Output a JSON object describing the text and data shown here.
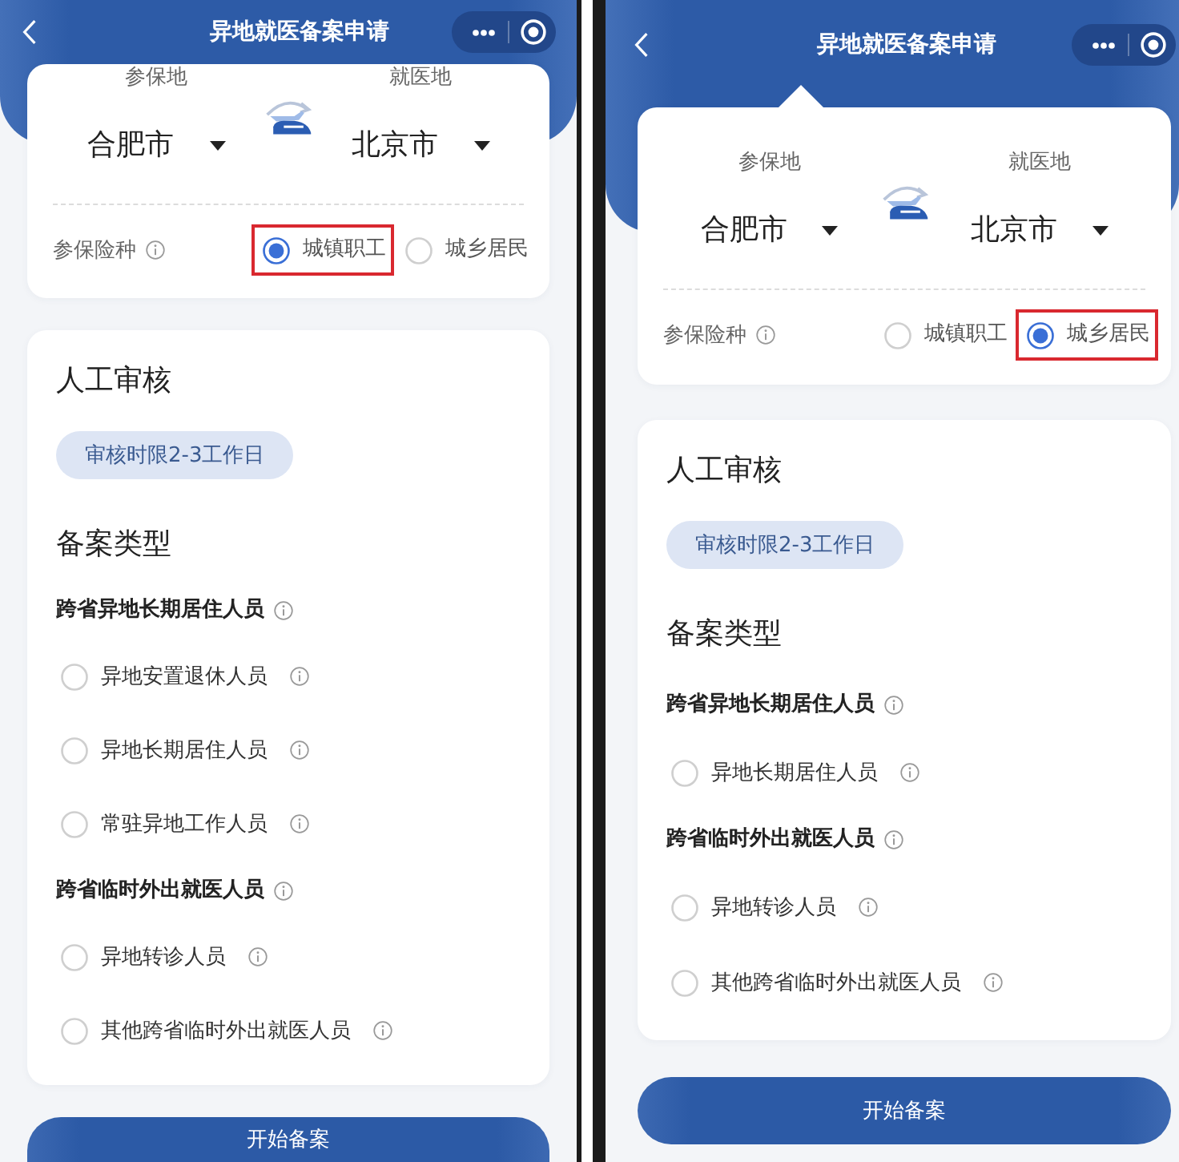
{
  "screens": [
    {
      "nav_bar": {
        "title": "异地就医备案申请"
      },
      "location_card": {
        "insured_place": {
          "label": "参保地",
          "city": "合肥市"
        },
        "treatment_place": {
          "label": "就医地",
          "city": "北京市"
        },
        "insurance_type": {
          "label": "参保险种",
          "options": [
            {
              "label": "城镇职工",
              "selected": true,
              "highlighted": true
            },
            {
              "label": "城乡居民",
              "selected": false,
              "highlighted": false
            }
          ]
        }
      },
      "review_card": {
        "title": "人工审核",
        "badge": "审核时限2-3工作日",
        "section_title": "备案类型",
        "groups": [
          {
            "title": "跨省异地长期居住人员",
            "options": [
              {
                "label": "异地安置退休人员",
                "selected": false
              },
              {
                "label": "异地长期居住人员",
                "selected": false
              },
              {
                "label": "常驻异地工作人员",
                "selected": false
              }
            ]
          },
          {
            "title": "跨省临时外出就医人员",
            "options": [
              {
                "label": "异地转诊人员",
                "selected": false
              },
              {
                "label": "其他跨省临时外出就医人员",
                "selected": false
              }
            ]
          }
        ]
      },
      "submit_button": {
        "label": "开始备案"
      }
    },
    {
      "nav_bar": {
        "title": "异地就医备案申请"
      },
      "location_card": {
        "insured_place": {
          "label": "参保地",
          "city": "合肥市"
        },
        "treatment_place": {
          "label": "就医地",
          "city": "北京市"
        },
        "insurance_type": {
          "label": "参保险种",
          "options": [
            {
              "label": "城镇职工",
              "selected": false,
              "highlighted": false
            },
            {
              "label": "城乡居民",
              "selected": true,
              "highlighted": true
            }
          ]
        }
      },
      "review_card": {
        "title": "人工审核",
        "badge": "审核时限2-3工作日",
        "section_title": "备案类型",
        "groups": [
          {
            "title": "跨省异地长期居住人员",
            "options": [
              {
                "label": "异地长期居住人员",
                "selected": false
              }
            ]
          },
          {
            "title": "跨省临时外出就医人员",
            "options": [
              {
                "label": "异地转诊人员",
                "selected": false
              },
              {
                "label": "其他跨省临时外出就医人员",
                "selected": false
              }
            ]
          }
        ]
      },
      "submit_button": {
        "label": "开始备案"
      }
    }
  ]
}
